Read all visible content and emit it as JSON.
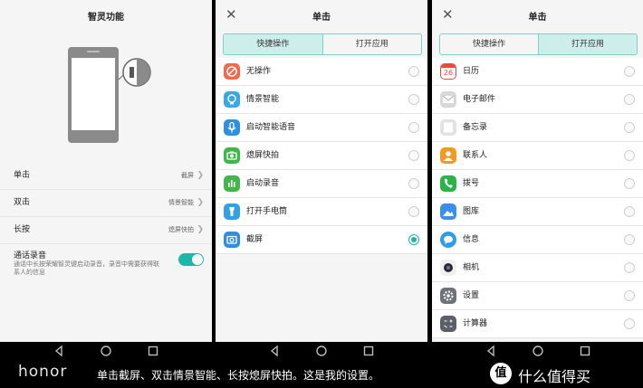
{
  "panel1": {
    "title": "智灵功能",
    "rows": [
      {
        "label": "单击",
        "value": "截屏"
      },
      {
        "label": "双击",
        "value": "情景智能"
      },
      {
        "label": "长按",
        "value": "熄屏快拍"
      }
    ],
    "call_record": {
      "label": "通话录音",
      "desc": "通话中长按荣耀智灵键启动录音，录音中需要获得联系人的信息",
      "enabled": true
    }
  },
  "panel2": {
    "title": "单击",
    "tabs": [
      "快捷操作",
      "打开应用"
    ],
    "active_tab": 0,
    "items": [
      {
        "label": "无操作",
        "icon": "no-action-icon",
        "color": "#f26a4b"
      },
      {
        "label": "情景智能",
        "icon": "lightbulb-icon",
        "color": "#3aa7e8"
      },
      {
        "label": "启动智能语音",
        "icon": "microphone-icon",
        "color": "#2f8fe0"
      },
      {
        "label": "熄屏快拍",
        "icon": "camera-icon",
        "color": "#3cb84a"
      },
      {
        "label": "启动录音",
        "icon": "recorder-icon",
        "color": "#44b54a"
      },
      {
        "label": "打开手电筒",
        "icon": "flashlight-icon",
        "color": "#32a0e6"
      },
      {
        "label": "截屏",
        "icon": "screenshot-icon",
        "color": "#2f8fe0"
      }
    ],
    "selected_index": 6
  },
  "panel3": {
    "title": "单击",
    "tabs": [
      "快捷操作",
      "打开应用"
    ],
    "active_tab": 1,
    "apps": [
      {
        "label": "日历",
        "icon": "calendar-icon",
        "color": "#e8493f",
        "badge": "26"
      },
      {
        "label": "电子邮件",
        "icon": "email-icon",
        "color": "#d8d8d8"
      },
      {
        "label": "备忘录",
        "icon": "memo-icon",
        "color": "#e2e2e2"
      },
      {
        "label": "联系人",
        "icon": "contacts-icon",
        "color": "#f29a26"
      },
      {
        "label": "拨号",
        "icon": "phone-icon",
        "color": "#2cb34a"
      },
      {
        "label": "图库",
        "icon": "gallery-icon",
        "color": "#3a8fe6"
      },
      {
        "label": "信息",
        "icon": "message-icon",
        "color": "#2f9ee6"
      },
      {
        "label": "相机",
        "icon": "camera-app-icon",
        "color": "#f0f0f0"
      },
      {
        "label": "设置",
        "icon": "settings-icon",
        "color": "#6e7378"
      },
      {
        "label": "计算器",
        "icon": "calculator-icon",
        "color": "#5c6066"
      }
    ]
  },
  "caption": {
    "brand": "honor",
    "text": "单击截屏、双击情景智能、长按熄屏快拍。这是我的设置。",
    "watermark_icon": "值",
    "watermark": "什么值得买"
  }
}
